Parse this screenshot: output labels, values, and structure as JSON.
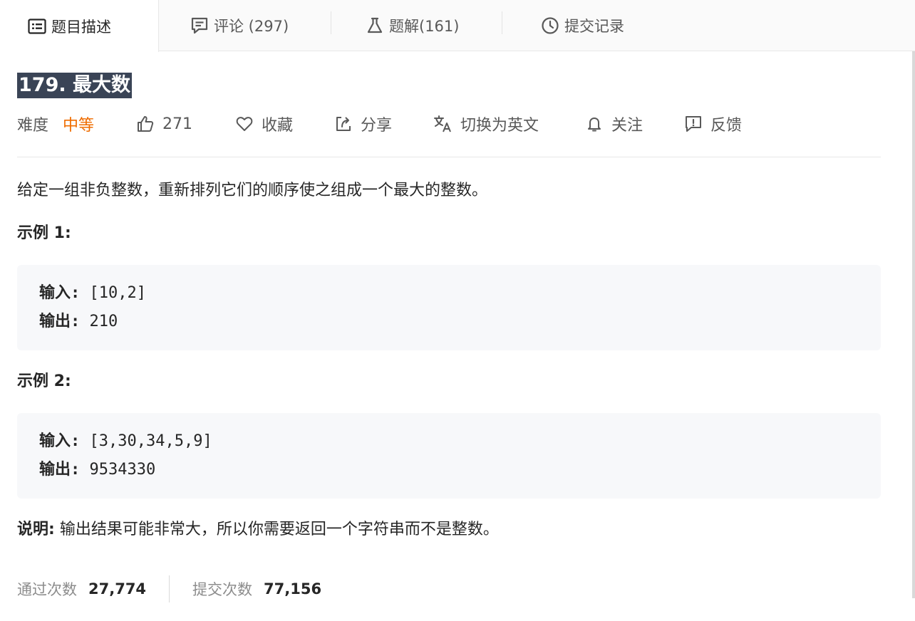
{
  "tabs": {
    "description": {
      "label": "题目描述",
      "icon": "document-icon"
    },
    "comments": {
      "label": "评论 (297)",
      "icon": "comment-icon"
    },
    "solutions": {
      "label": "题解(161)",
      "icon": "flask-icon"
    },
    "submissions": {
      "label": "提交记录",
      "icon": "clock-icon"
    }
  },
  "problem": {
    "title": "179. 最大数",
    "difficulty_label": "难度",
    "difficulty_value": "中等",
    "likes": "271",
    "favorite_label": "收藏",
    "share_label": "分享",
    "switch_lang_label": "切换为英文",
    "follow_label": "关注",
    "feedback_label": "反馈",
    "description": "给定一组非负整数，重新排列它们的顺序使之组成一个最大的整数。",
    "examples": [
      {
        "title": "示例 1:",
        "input_label": "输入:",
        "input": "[10,2]",
        "output_label": "输出:",
        "output": "210"
      },
      {
        "title": "示例 2:",
        "input_label": "输入:",
        "input": "[3,30,34,5,9]",
        "output_label": "输出:",
        "output": "9534330"
      }
    ],
    "note_label": "说明:",
    "note_text": "输出结果可能非常大，所以你需要返回一个字符串而不是整数。"
  },
  "stats": {
    "accepted_label": "通过次数",
    "accepted_value": "27,774",
    "submissions_label": "提交次数",
    "submissions_value": "77,156"
  },
  "colors": {
    "difficulty_medium": "#ef6c00",
    "title_highlight_bg": "#3a4456",
    "code_bg": "#f7f8fa"
  }
}
